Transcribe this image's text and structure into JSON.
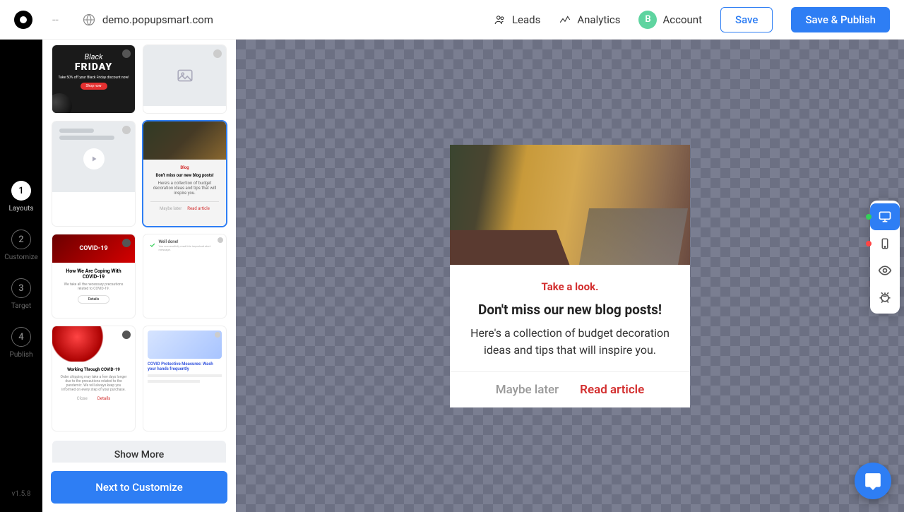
{
  "topbar": {
    "title": "--",
    "domain": "demo.popupsmart.com",
    "leads": "Leads",
    "analytics": "Analytics",
    "account": "Account",
    "avatar_letter": "B",
    "save": "Save",
    "publish": "Save & Publish"
  },
  "rail": {
    "items": [
      {
        "num": "1",
        "label": "Layouts",
        "active": true
      },
      {
        "num": "2",
        "label": "Customize",
        "active": false
      },
      {
        "num": "3",
        "label": "Target",
        "active": false
      },
      {
        "num": "4",
        "label": "Publish",
        "active": false
      }
    ],
    "version": "v1.5.8"
  },
  "panel": {
    "templates": {
      "blackfriday": {
        "line1": "Black",
        "line2": "FRIDAY",
        "line3": "Take 50% off your Black Friday discount now!",
        "cta": "Shop now"
      },
      "blog": {
        "eyebrow": "Blog",
        "heading": "Don't miss our new blog posts!",
        "body": "Here's a collection of budget decoration ideas and tips that will inspire you.",
        "btn1": "Maybe later",
        "btn2": "Read article"
      },
      "covid": {
        "badge": "COVID-19",
        "heading": "How We Are Coping With COVID-19",
        "body": "We take all the necessary precautions related to COVID-19.",
        "cta": "Details"
      },
      "welldone": {
        "title": "Well done!",
        "body": "You successfully read this important alert message."
      },
      "virus": {
        "heading": "Working Through COVID-19",
        "body": "Order shipping may take a few days longer due to the precautions related to the pandemic. We will always keep you informed on every step of your purchase.",
        "btn1": "Close",
        "btn2": "Details"
      },
      "wash": {
        "heading": "COVID Protective Measures: Wash your hands frequently"
      }
    },
    "show_more": "Show More",
    "next": "Next to Customize"
  },
  "popup": {
    "eyebrow": "Take a look.",
    "title": "Don't miss our new blog posts!",
    "desc": "Here's a collection of budget decoration ideas and tips that will inspire you.",
    "btn_secondary": "Maybe later",
    "btn_primary": "Read article"
  }
}
